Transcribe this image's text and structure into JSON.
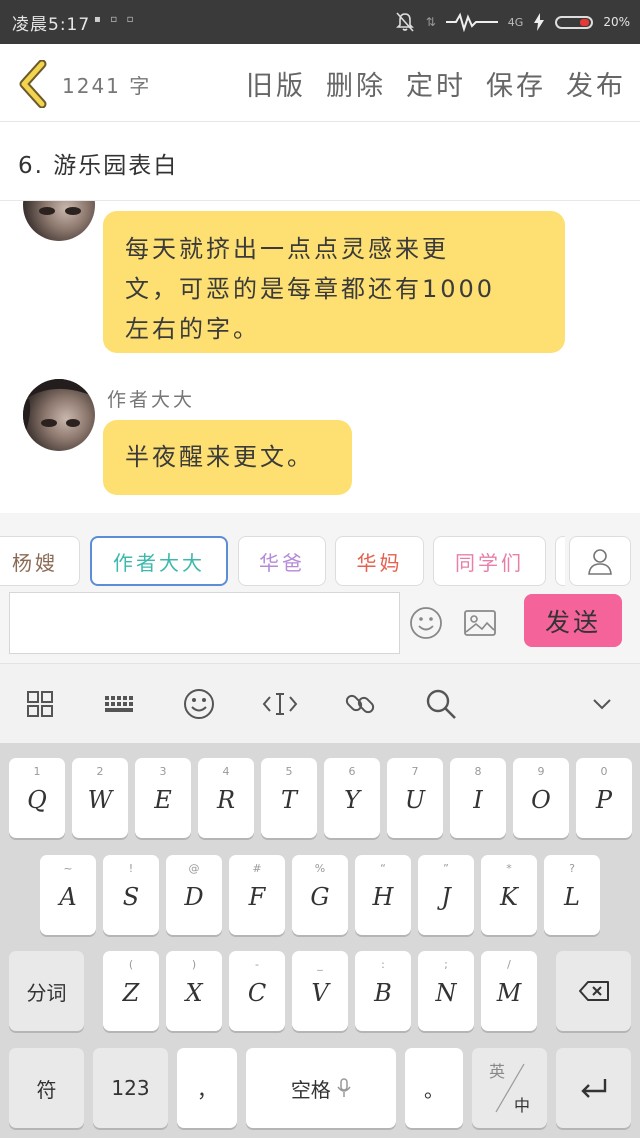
{
  "status_bar": {
    "time": "凌晨5:17",
    "network": "4G",
    "battery": "20%"
  },
  "header": {
    "word_count": "1241 字",
    "actions": [
      "旧版",
      "删除",
      "定时",
      "保存",
      "发布"
    ]
  },
  "document": {
    "title": "6. 游乐园表白"
  },
  "messages": [
    {
      "sender": "",
      "text_lines": [
        "每天就挤出一点点灵感来更",
        "文，可恶的是每章都还有1000",
        "左右的字。"
      ]
    },
    {
      "sender": "作者大大",
      "text_lines": [
        "半夜醒来更文。"
      ]
    }
  ],
  "roles": [
    {
      "label": "杨嫂",
      "color": "#8a6a55"
    },
    {
      "label": "作者大大",
      "color": "#3cb8ad"
    },
    {
      "label": "华爸",
      "color": "#b58ad9"
    },
    {
      "label": "华妈",
      "color": "#e4604f"
    },
    {
      "label": "同学们",
      "color": "#e77fa9"
    }
  ],
  "composer": {
    "input_value": "",
    "send_label": "发送"
  },
  "keyboard": {
    "row1": [
      {
        "key": "Q",
        "sub": "1"
      },
      {
        "key": "W",
        "sub": "2"
      },
      {
        "key": "E",
        "sub": "3"
      },
      {
        "key": "R",
        "sub": "4"
      },
      {
        "key": "T",
        "sub": "5"
      },
      {
        "key": "Y",
        "sub": "6"
      },
      {
        "key": "U",
        "sub": "7"
      },
      {
        "key": "I",
        "sub": "8"
      },
      {
        "key": "O",
        "sub": "9"
      },
      {
        "key": "P",
        "sub": "0"
      }
    ],
    "row2": [
      {
        "key": "A",
        "sub": "~"
      },
      {
        "key": "S",
        "sub": "!"
      },
      {
        "key": "D",
        "sub": "@"
      },
      {
        "key": "F",
        "sub": "#"
      },
      {
        "key": "G",
        "sub": "%"
      },
      {
        "key": "H",
        "sub": "“"
      },
      {
        "key": "J",
        "sub": "”"
      },
      {
        "key": "K",
        "sub": "*"
      },
      {
        "key": "L",
        "sub": "?"
      }
    ],
    "row3": [
      {
        "key": "Z",
        "sub": "("
      },
      {
        "key": "X",
        "sub": ")"
      },
      {
        "key": "C",
        "sub": "-"
      },
      {
        "key": "V",
        "sub": "_"
      },
      {
        "key": "B",
        "sub": ":"
      },
      {
        "key": "N",
        "sub": ";"
      },
      {
        "key": "M",
        "sub": "/"
      }
    ],
    "fenci": "分词",
    "fu": "符",
    "num": "123",
    "comma": "，",
    "space": "空格",
    "period": "。",
    "lang_top": "英",
    "lang_bottom": "中"
  }
}
